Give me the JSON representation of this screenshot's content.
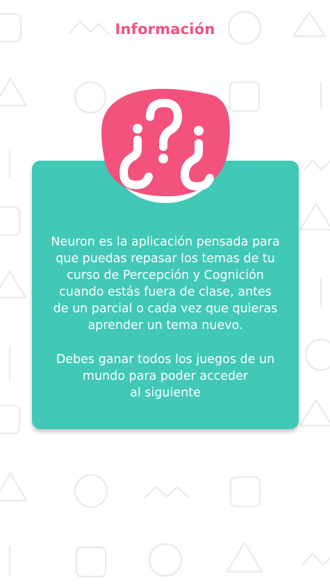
{
  "header": {
    "title": "Información"
  },
  "info": {
    "badge_icon": "question-marks-icon",
    "paragraph_1": "Neuron es la aplicación pensada para\nque puedas repasar los temas de tu\ncurso de Percepción y Cognición\ncuando estás fuera de clase, antes\nde un parcial o cada vez que quieras\naprender un tema nuevo.",
    "paragraph_2": "Debes ganar todos los juegos de un\nmundo para poder acceder\nal siguiente"
  },
  "colors": {
    "title": "#f2527c",
    "card": "#41c8b7",
    "badge": "#f2527c",
    "pattern": "#ebebeb"
  }
}
